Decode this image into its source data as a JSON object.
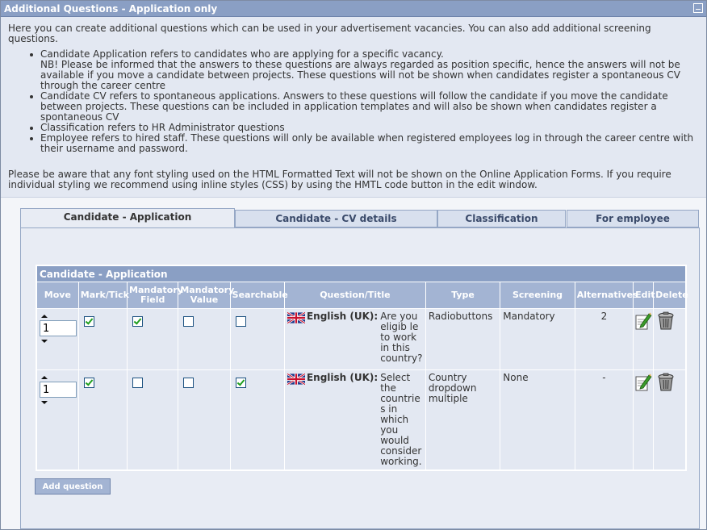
{
  "window": {
    "title": "Additional Questions - Application only"
  },
  "intro_text": "Here you can create additional questions which can be used in your advertisement vacancies. You can also add additional screening questions.",
  "bullets": [
    "Candidate Application refers to candidates who are applying for a specific vacancy.\nNB! Please be informed that the answers to these questions are always regarded as position specific, hence the answers will not be available if you move a candidate between projects. These questions will not be shown when candidates register a spontaneous CV through the career centre",
    "Candidate CV refers to spontaneous applications. Answers to these questions will follow the candidate if you move the candidate between projects. These questions can be included in application templates and will also be shown when candidates register a spontaneous CV",
    "Classification refers to HR Administrator questions",
    "Employee refers to hired staff. These questions will only be available when registered employees log in through the career centre with their username and password."
  ],
  "styling_note": "Please be aware that any font styling used on the HTML Formatted Text will not be shown on the Online Application Forms. If you require individual styling we recommend using inline styles (CSS) by using the HMTL code button in the edit window.",
  "tabs": [
    {
      "label": "Candidate - Application",
      "active": true
    },
    {
      "label": "Candidate - CV details",
      "active": false
    },
    {
      "label": "Classification",
      "active": false
    },
    {
      "label": "For employee",
      "active": false
    }
  ],
  "grid": {
    "caption": "Candidate - Application",
    "columns": [
      "Move",
      "Mark/Tick",
      "Mandatory Field",
      "Mandatory Value",
      "Searchable",
      "Question/Title",
      "Type",
      "Screening",
      "Alternatives",
      "Edit",
      "Delete"
    ],
    "rows": [
      {
        "move": "1",
        "mark_tick": true,
        "mandatory_field": true,
        "mandatory_value": false,
        "searchable": false,
        "language": "English (UK):",
        "question": "Are you eligib le to work in this country?",
        "type": "Radiobuttons",
        "screening": "Mandatory",
        "alternatives": "2"
      },
      {
        "move": "1",
        "mark_tick": true,
        "mandatory_field": false,
        "mandatory_value": false,
        "searchable": true,
        "language": "English (UK):",
        "question": "Select the countries in which you would consider working.",
        "type": "Country dropdown multiple",
        "screening": "None",
        "alternatives": "-"
      }
    ]
  },
  "buttons": {
    "add_question": "Add question"
  },
  "icons": {
    "collapse": "collapse-icon",
    "flag": "uk-flag-icon",
    "edit": "edit-pencil-icon",
    "delete": "trash-can-icon",
    "move_up": "arrow-up-icon",
    "move_down": "arrow-down-icon"
  },
  "colors": {
    "titlebar": "#8a9fc4",
    "header": "#a3b4d3",
    "panel": "#e3e8f2",
    "check": "#1f9e1f"
  }
}
